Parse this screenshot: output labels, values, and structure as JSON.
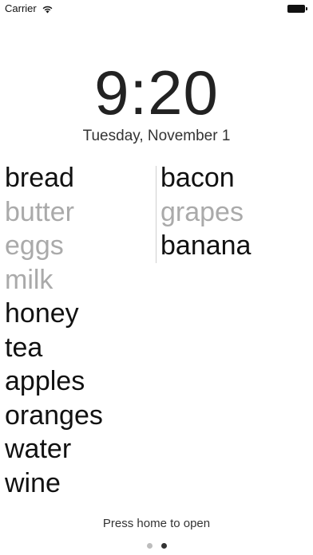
{
  "status_bar": {
    "carrier": "Carrier",
    "wifi_icon": "wifi-icon",
    "battery_icon": "battery-icon"
  },
  "lock_screen": {
    "time": "9:20",
    "date": "Tuesday, November 1",
    "hint": "Press home to open"
  },
  "list": {
    "left_column": [
      {
        "label": "bread",
        "checked": false
      },
      {
        "label": "butter",
        "checked": true
      },
      {
        "label": "eggs",
        "checked": true
      },
      {
        "label": "milk",
        "checked": true
      },
      {
        "label": "honey",
        "checked": false
      },
      {
        "label": "tea",
        "checked": false
      },
      {
        "label": "apples",
        "checked": false
      },
      {
        "label": "oranges",
        "checked": false
      },
      {
        "label": "water",
        "checked": false
      },
      {
        "label": "wine",
        "checked": false
      }
    ],
    "right_column": [
      {
        "label": "bacon",
        "checked": false
      },
      {
        "label": "grapes",
        "checked": true
      },
      {
        "label": "banana",
        "checked": false
      }
    ]
  },
  "page_indicator": {
    "pages": 2,
    "active_index": 1
  },
  "colors": {
    "done_text": "#aaaaaa",
    "todo_text": "#111111",
    "dot_active": "#333333",
    "dot_inactive": "#bdbdbd"
  }
}
